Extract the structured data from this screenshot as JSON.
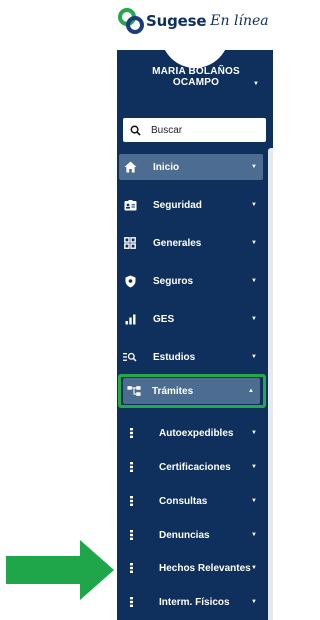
{
  "logo": {
    "brand": "Sugese",
    "tagline": "En línea",
    "icon": "ribbon-logo-icon",
    "colors": {
      "green": "#23a84a",
      "blue": "#1b3d7a"
    }
  },
  "user": {
    "name": "MARIA BOLAÑOS OCAMPO",
    "caret": "▼"
  },
  "search": {
    "placeholder": "Buscar",
    "value": "",
    "icon": "search-icon"
  },
  "menu": {
    "items": [
      {
        "label": "Inicio",
        "icon": "home-icon",
        "caret": "▼",
        "active": true
      },
      {
        "label": "Seguridad",
        "icon": "id-card-icon",
        "caret": "▼"
      },
      {
        "label": "Generales",
        "icon": "grid-icon",
        "caret": "▼"
      },
      {
        "label": "Seguros",
        "icon": "shield-icon",
        "caret": "▼"
      },
      {
        "label": "GES",
        "icon": "bar-chart-icon",
        "caret": "▼"
      },
      {
        "label": "Estudios",
        "icon": "list-search-icon",
        "caret": "▼"
      },
      {
        "label": "Trámites",
        "icon": "sitemap-icon",
        "caret": "▲",
        "expanded": true
      }
    ],
    "subitems": [
      {
        "label": "Autoexpedibles",
        "icon": "vertical-dots-icon",
        "caret": "▼"
      },
      {
        "label": "Certificaciones",
        "icon": "vertical-dots-icon",
        "caret": "▼"
      },
      {
        "label": "Consultas",
        "icon": "vertical-dots-icon",
        "caret": "▼"
      },
      {
        "label": "Denuncias",
        "icon": "vertical-dots-icon",
        "caret": "▼"
      },
      {
        "label": "Hechos Relevantes",
        "icon": "vertical-dots-icon",
        "caret": "▼"
      },
      {
        "label": "Interm. Físicos",
        "icon": "vertical-dots-icon",
        "caret": "▼"
      }
    ]
  },
  "annotations": {
    "highlight_color": "#23a84a",
    "arrow_color": "#23a84a",
    "highlighted_item": "Trámites",
    "arrow_target": "Hechos Relevantes"
  },
  "theme": {
    "sidebar_bg": "#0f2f5c",
    "active_bg": "#4c6d91",
    "text": "#ffffff"
  }
}
